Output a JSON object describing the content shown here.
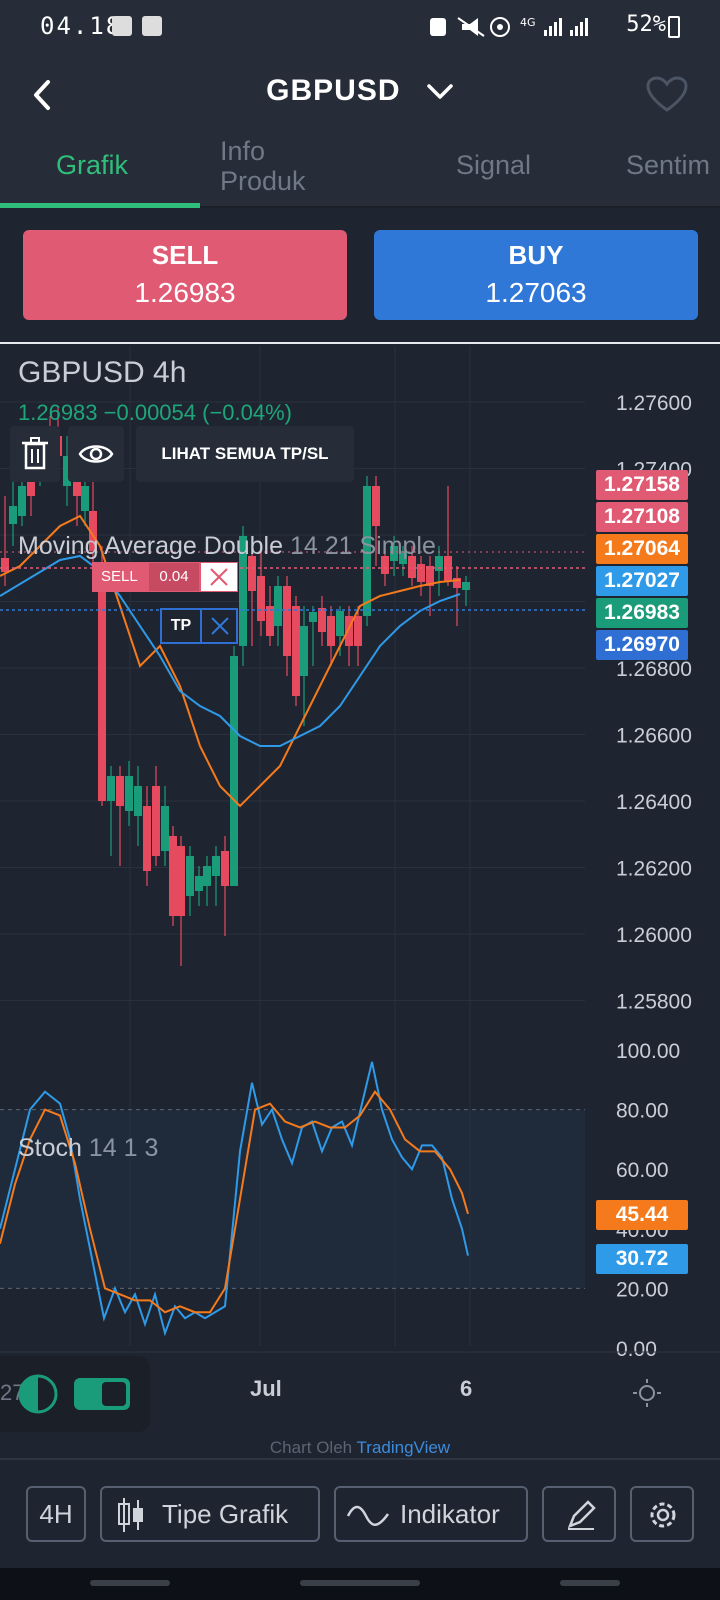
{
  "status": {
    "time": "04.18",
    "battery": "52%"
  },
  "header": {
    "title": "GBPUSD"
  },
  "tabs": [
    {
      "label": "Grafik"
    },
    {
      "label": "Info Produk"
    },
    {
      "label": "Signal"
    },
    {
      "label": "Sentim"
    }
  ],
  "trade": {
    "sell_label": "SELL",
    "sell_price": "1.26983",
    "buy_label": "BUY",
    "buy_price": "1.27063"
  },
  "chart": {
    "symbol": "GBPUSD  4h",
    "quote": "1.26983 −0.00054 (−0.04%)",
    "tp_sl_button": "LIHAT SEMUA TP/SL",
    "ma_name": "Moving Average Double",
    "ma_params": "14 21 Simple",
    "order_sell_label": "SELL",
    "order_sell_size": "0.04",
    "order_tp_label": "TP",
    "stoch_name": "Stoch",
    "stoch_params": "14 1 3",
    "date_labels": [
      "Jul",
      "6"
    ],
    "left_cut_label": "27",
    "attribution_prefix": "Chart Oleh",
    "attribution_brand": "TradingView"
  },
  "price_axis": [
    "1.27600",
    "1.27400",
    "1.26800",
    "1.26600",
    "1.26400",
    "1.26200",
    "1.26000",
    "1.25800"
  ],
  "price_tags": [
    {
      "value": "1.27158",
      "color": "#e05a74"
    },
    {
      "value": "1.27108",
      "color": "#e05a74"
    },
    {
      "value": "1.27064",
      "color": "#f57a1c"
    },
    {
      "value": "1.27027",
      "color": "#2f9ae8"
    },
    {
      "value": "1.26983",
      "color": "#1a9b79"
    },
    {
      "value": "1.26970",
      "color": "#2f6fd4"
    }
  ],
  "stoch_axis": [
    "100.00",
    "80.00",
    "60.00",
    "40.00",
    "20.00",
    "0.00"
  ],
  "stoch_tags": [
    {
      "value": "45.44",
      "color": "#f57a1c"
    },
    {
      "value": "30.72",
      "color": "#2f9ae8"
    }
  ],
  "toolbar": {
    "interval": "4H",
    "chart_type": "Tipe Grafik",
    "indicator": "Indikator"
  },
  "colors": {
    "up": "#1a9b79",
    "down": "#e64a5e",
    "accent": "#2fbf7a",
    "ma_fast": "#f57a1c",
    "ma_slow": "#2f9ae8"
  }
}
